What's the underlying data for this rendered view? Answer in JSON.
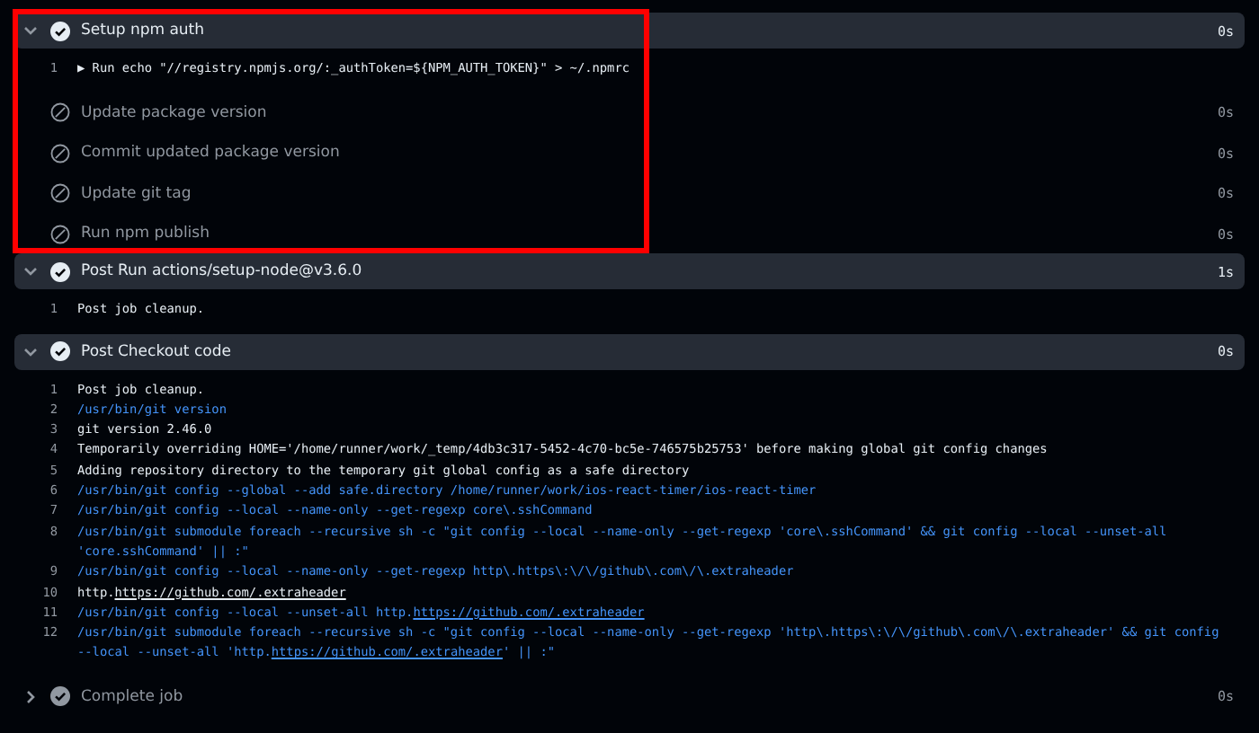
{
  "steps": [
    {
      "title": "Setup npm auth",
      "kind": "success",
      "expanded": true,
      "highlighted": true,
      "duration": "0s",
      "lines": [
        {
          "number": "1",
          "kind": "output",
          "parts": [
            {
              "text": "▶ Run echo \"//registry.npmjs.org/:_authToken=${NPM_AUTH_TOKEN}\" > ~/.npmrc",
              "kind": "text"
            }
          ]
        }
      ]
    },
    {
      "title": "Update package version",
      "kind": "skipped",
      "expanded": false,
      "highlighted": true,
      "duration": "0s"
    },
    {
      "title": "Commit updated package version",
      "kind": "skipped",
      "expanded": false,
      "highlighted": true,
      "duration": "0s"
    },
    {
      "title": "Update git tag",
      "kind": "skipped",
      "expanded": false,
      "highlighted": true,
      "duration": "0s"
    },
    {
      "title": "Run npm publish",
      "kind": "skipped",
      "expanded": false,
      "highlighted": true,
      "duration": "0s"
    },
    {
      "title": "Post Run actions/setup-node@v3.6.0",
      "kind": "success",
      "expanded": true,
      "duration": "1s",
      "lines": [
        {
          "number": "1",
          "kind": "output",
          "parts": [
            {
              "text": "Post job cleanup.",
              "kind": "text"
            }
          ]
        }
      ]
    },
    {
      "title": "Post Checkout code",
      "kind": "success",
      "expanded": true,
      "duration": "0s",
      "lines": [
        {
          "number": "1",
          "kind": "output",
          "parts": [
            {
              "text": "Post job cleanup.",
              "kind": "text"
            }
          ]
        },
        {
          "number": "2",
          "kind": "command",
          "parts": [
            {
              "text": "/usr/bin/git version",
              "kind": "text"
            }
          ]
        },
        {
          "number": "3",
          "kind": "output",
          "parts": [
            {
              "text": "git version 2.46.0",
              "kind": "text"
            }
          ]
        },
        {
          "number": "4",
          "kind": "output",
          "parts": [
            {
              "text": "Temporarily overriding HOME='/home/runner/work/_temp/4db3c317-5452-4c70-bc5e-746575b25753' before making global git config changes",
              "kind": "text"
            }
          ]
        },
        {
          "number": "5",
          "kind": "output",
          "parts": [
            {
              "text": "Adding repository directory to the temporary git global config as a safe directory",
              "kind": "text"
            }
          ]
        },
        {
          "number": "6",
          "kind": "command",
          "parts": [
            {
              "text": "/usr/bin/git config --global --add safe.directory /home/runner/work/ios-react-timer/ios-react-timer",
              "kind": "text"
            }
          ]
        },
        {
          "number": "7",
          "kind": "command",
          "parts": [
            {
              "text": "/usr/bin/git config --local --name-only --get-regexp core\\.sshCommand",
              "kind": "text"
            }
          ]
        },
        {
          "number": "8",
          "kind": "command",
          "parts": [
            {
              "text": "/usr/bin/git submodule foreach --recursive sh -c \"git config --local --name-only --get-regexp 'core\\.sshCommand' && git config --local --unset-all 'core.sshCommand' || :\"",
              "kind": "text"
            }
          ]
        },
        {
          "number": "9",
          "kind": "command",
          "parts": [
            {
              "text": "/usr/bin/git config --local --name-only --get-regexp http\\.https\\:\\/\\/github\\.com\\/\\.extraheader",
              "kind": "text"
            }
          ]
        },
        {
          "number": "10",
          "kind": "output",
          "parts": [
            {
              "text": "http.",
              "kind": "text"
            },
            {
              "text": "https://github.com/.extraheader",
              "kind": "link"
            }
          ]
        },
        {
          "number": "11",
          "kind": "command",
          "parts": [
            {
              "text": "/usr/bin/git config --local --unset-all http.",
              "kind": "text"
            },
            {
              "text": "https://github.com/.extraheader",
              "kind": "link"
            }
          ]
        },
        {
          "number": "12",
          "kind": "command",
          "parts": [
            {
              "text": "/usr/bin/git submodule foreach --recursive sh -c \"git config --local --name-only --get-regexp 'http\\.https\\:\\/\\/github\\.com\\/\\.extraheader' && git config --local --unset-all 'http.",
              "kind": "text"
            },
            {
              "text": "https://github.com/.extraheader",
              "kind": "link"
            },
            {
              "text": "' || :\"",
              "kind": "text"
            }
          ]
        }
      ]
    },
    {
      "title": "Complete job",
      "kind": "success",
      "expanded": false,
      "duration": "0s"
    }
  ]
}
